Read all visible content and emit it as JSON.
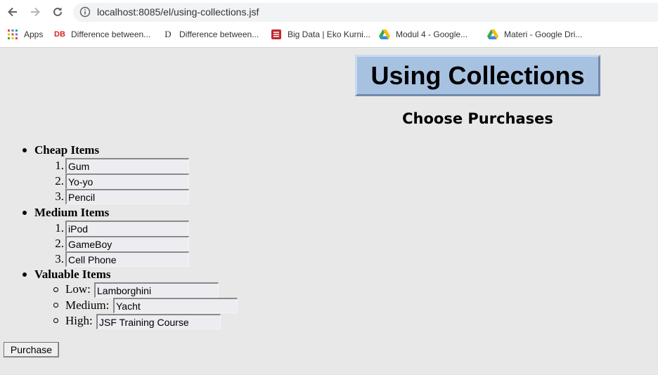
{
  "browser": {
    "url": "localhost:8085/el/using-collections.jsf",
    "bookmarks": [
      {
        "label": "Apps",
        "icon": "apps-grid-icon"
      },
      {
        "label": "Difference between...",
        "icon": "db-favicon"
      },
      {
        "label": "Difference between...",
        "icon": "d-favicon"
      },
      {
        "label": "Big Data | Eko Kurni...",
        "icon": "bigdata-favicon"
      },
      {
        "label": "Modul 4 - Google...",
        "icon": "google-drive-icon"
      },
      {
        "label": "Materi - Google Dri...",
        "icon": "google-drive-icon"
      }
    ]
  },
  "page": {
    "title": "Using Collections",
    "subtitle": "Choose Purchases",
    "categories": {
      "cheap": {
        "label": "Cheap Items",
        "items": [
          {
            "num": "1.",
            "value": "Gum"
          },
          {
            "num": "2.",
            "value": "Yo-yo"
          },
          {
            "num": "3.",
            "value": "Pencil"
          }
        ]
      },
      "medium": {
        "label": "Medium Items",
        "items": [
          {
            "num": "1.",
            "value": "iPod"
          },
          {
            "num": "2.",
            "value": "GameBoy"
          },
          {
            "num": "3.",
            "value": "Cell Phone"
          }
        ]
      },
      "valuable": {
        "label": "Valuable Items",
        "items": [
          {
            "label": "Low:",
            "value": "Lamborghini"
          },
          {
            "label": "Medium:",
            "value": "Yacht"
          },
          {
            "label": "High:",
            "value": "JSF Training Course"
          }
        ]
      }
    },
    "purchase_label": "Purchase"
  },
  "colors": {
    "page_bg": "#e8e8e8",
    "title_bg": "#a7c1e1",
    "field_bg": "#ececf1"
  }
}
